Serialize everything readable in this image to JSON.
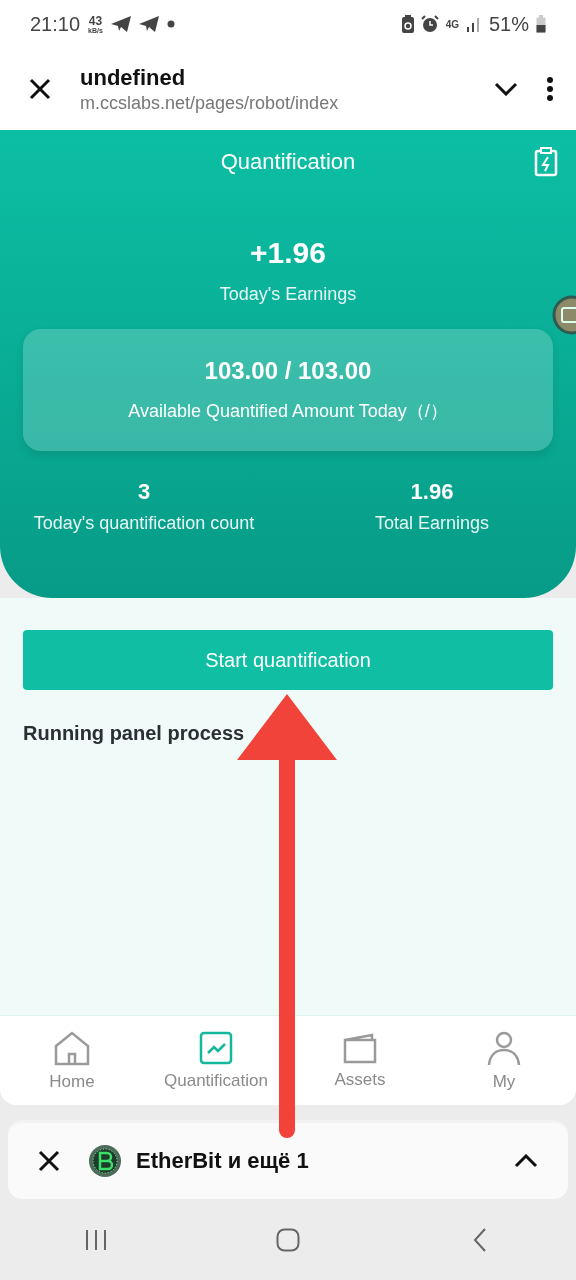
{
  "status_bar": {
    "time": "21:10",
    "net_speed": "43",
    "net_unit": "kB/s",
    "network": "4G",
    "battery": "51%"
  },
  "browser": {
    "title": "undefined",
    "url": "m.ccslabs.net/pages/robot/index"
  },
  "header": {
    "title": "Quantification",
    "earnings": "+1.96",
    "earnings_label": "Today's Earnings",
    "amount": "103.00 / 103.00",
    "amount_label": "Available Quantified Amount Today（/）",
    "stats": [
      {
        "value": "3",
        "label": "Today's quantification count"
      },
      {
        "value": "1.96",
        "label": "Total Earnings"
      }
    ]
  },
  "start_button": "Start quantification",
  "section_title": "Running panel process",
  "nav": [
    {
      "label": "Home",
      "selected": false
    },
    {
      "label": "Quantification",
      "selected": true
    },
    {
      "label": "Assets",
      "selected": false
    },
    {
      "label": "My",
      "selected": false
    }
  ],
  "notification": {
    "text": "EtherBit и ещё 1"
  }
}
